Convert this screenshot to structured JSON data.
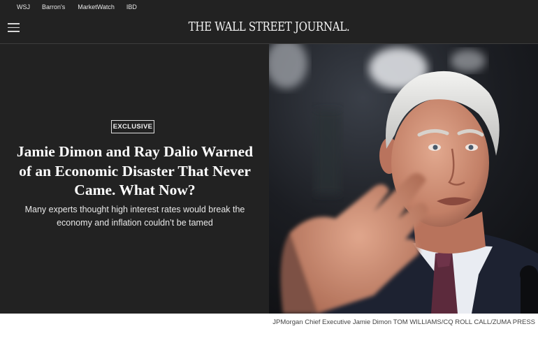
{
  "topnav": {
    "items": [
      "WSJ",
      "Barron's",
      "MarketWatch",
      "IBD"
    ]
  },
  "header": {
    "logo_text": "THE WALL STREET JOURNAL.",
    "menu_icon": "hamburger-menu-icon"
  },
  "hero": {
    "badge": "EXCLUSIVE",
    "headline": "Jamie Dimon and Ray Dalio Warned of an Economic Disaster That Never Came. What Now?",
    "dek": "Many experts thought high interest rates would break the economy and inflation couldn’t be tamed",
    "image_caption": "JPMorgan Chief Executive Jamie Dimon TOM WILLIAMS/CQ ROLL CALL/ZUMA PRESS"
  },
  "colors": {
    "background": "#222222",
    "text": "#ffffff",
    "caption_background": "#ffffff"
  }
}
